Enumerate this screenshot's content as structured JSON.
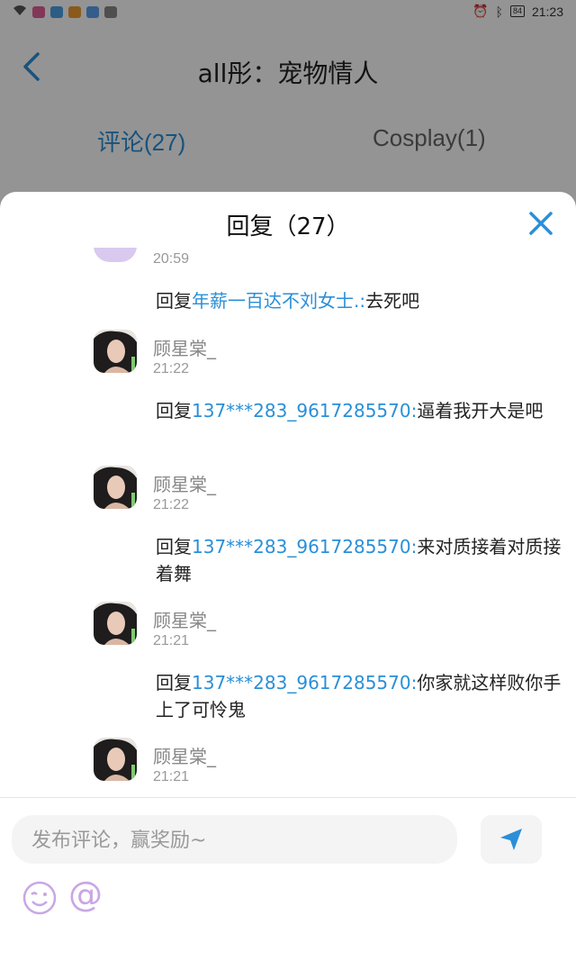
{
  "status_bar": {
    "time": "21:23",
    "battery": "84"
  },
  "header": {
    "title": "all彤：宠物情人"
  },
  "tabs": [
    {
      "label": "评论(27)",
      "active": true
    },
    {
      "label": "Cosplay(1)",
      "active": false
    }
  ],
  "sheet": {
    "title": "回复（27）",
    "items": [
      {
        "time": "20:59",
        "reply_prefix": "回复",
        "reply_to": "年薪一百达不刘女士.:",
        "reply_text": "去死吧"
      },
      {
        "user": "顾星棠_",
        "time": "21:22",
        "reply_prefix": "回复",
        "reply_to": "137***283_9617285570:",
        "reply_text": "逼着我开大是吧"
      },
      {
        "user": "顾星棠_",
        "time": "21:22",
        "reply_prefix": "回复",
        "reply_to": "137***283_9617285570:",
        "reply_text": "来对质接着对质接着舞"
      },
      {
        "user": "顾星棠_",
        "time": "21:21",
        "reply_prefix": "回复",
        "reply_to": "137***283_9617285570:",
        "reply_text": "你家就这样败你手上了可怜鬼"
      },
      {
        "user": "顾星棠_",
        "time": "21:21"
      }
    ]
  },
  "composer": {
    "placeholder": "发布评论，赢奖励~",
    "at_symbol": "@"
  },
  "colors": {
    "accent": "#2a8fd8",
    "send_icon": "#2a8fd8",
    "emoji": "#c9a6e6"
  }
}
